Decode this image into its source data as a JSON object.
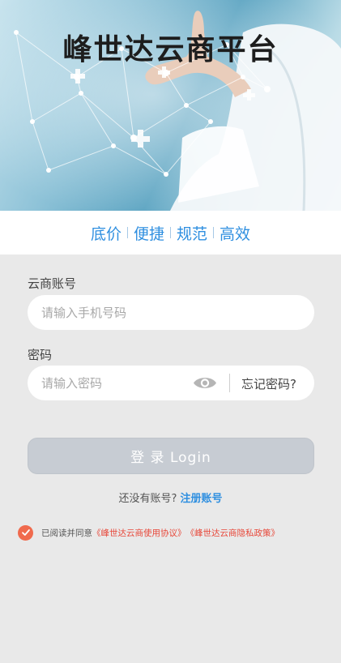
{
  "banner": {
    "title": "峰世达云商平台"
  },
  "slogan": [
    "底价",
    "便捷",
    "规范",
    "高效"
  ],
  "form": {
    "account_label": "云商账号",
    "phone_placeholder": "请输入手机号码",
    "password_label": "密码",
    "password_placeholder": "请输入密码",
    "forgot_label": "忘记密码?"
  },
  "login_button": "登 录 Login",
  "register": {
    "prompt": "还没有账号? ",
    "link": "注册账号"
  },
  "agreement": {
    "checked": true,
    "text": "已阅读并同意",
    "terms_link": "《峰世达云商使用协议》",
    "privacy_link": "《峰世达云商隐私政策》"
  },
  "colors": {
    "accent": "#2f8fe0",
    "link_red": "#e8483a",
    "check": "#f06a4d",
    "button_disabled": "#c7ccd3"
  }
}
